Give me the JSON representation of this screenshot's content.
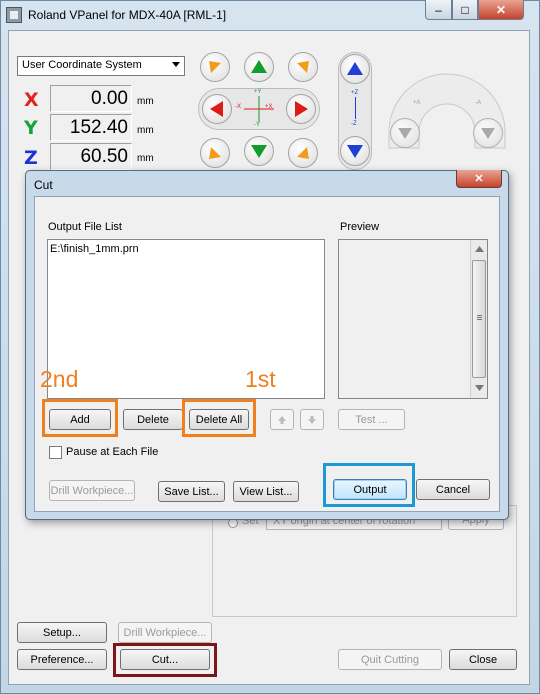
{
  "window": {
    "title": "Roland VPanel for MDX-40A [RML-1]",
    "min": "–",
    "max": "□",
    "close": "✕"
  },
  "coords": {
    "system": "User Coordinate System",
    "x": {
      "letter": "X",
      "value": "0.00",
      "unit": "mm",
      "color": "#e0261b"
    },
    "y": {
      "letter": "Y",
      "value": "152.40",
      "unit": "mm",
      "color": "#16a336"
    },
    "z": {
      "letter": "Z",
      "value": "60.50",
      "unit": "mm",
      "color": "#1b34d6"
    }
  },
  "jog": {
    "labels": {
      "plus_y": "+Y",
      "minus_y": "-Y",
      "plus_x": "+X",
      "minus_x": "-X",
      "plus_z": "+Z",
      "minus_z": "-Z",
      "plus_a": "+A",
      "minus_a": "-A"
    },
    "colors": {
      "orange": "#f39b1a",
      "green": "#139c2c",
      "red": "#df1b16",
      "blue": "#1f3fd8",
      "gray": "#9a9a9a"
    }
  },
  "dialog": {
    "title": "Cut",
    "close": "✕",
    "output_file_list_label": "Output File List",
    "preview_label": "Preview",
    "files": [
      "E:\\finish_1mm.prn"
    ],
    "buttons": {
      "add": "Add",
      "delete": "Delete",
      "delete_all": "Delete All",
      "test": "Test ...",
      "pause": "Pause at Each File",
      "drill": "Drill Workpiece...",
      "save_list": "Save List...",
      "view_list": "View List...",
      "output": "Output",
      "cancel": "Cancel"
    },
    "annotations": {
      "second": "2nd",
      "first": "1st"
    },
    "highlight_colors": {
      "orange": "#f07f1e",
      "blue": "#1b9ad7",
      "maroon": "#7c1518"
    }
  },
  "background_panel": {
    "set_label": "Set",
    "origin_option": "XY origin at center of rotation",
    "apply": "Apply"
  },
  "footer": {
    "setup": "Setup...",
    "drill": "Drill Workpiece...",
    "preference": "Preference...",
    "cut": "Cut...",
    "quit_cutting": "Quit Cutting",
    "close": "Close"
  }
}
